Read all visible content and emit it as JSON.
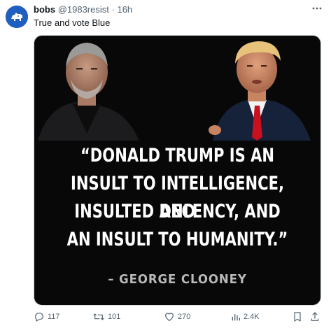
{
  "post": {
    "author_name": "bobs",
    "author_handle": "@1983resist",
    "separator": "·",
    "time": "16h",
    "text": "True and vote Blue",
    "more_icon": "more-horizontal-icon"
  },
  "media": {
    "quote_lines": [
      "“DONALD TRUMP IS AN",
      "INSULT TO INTELLIGENCE, AND",
      "INSULTED DECENCY, AND",
      "AN INSULT TO HUMANITY.”"
    ],
    "attribution": "– GEORGE CLOONEY"
  },
  "actions": {
    "replies": "117",
    "reposts": "101",
    "likes": "270",
    "views": "2.4K",
    "icons": [
      "reply-icon",
      "repost-icon",
      "like-icon",
      "views-icon",
      "bookmark-icon",
      "share-icon"
    ]
  },
  "colors": {
    "accent": "#1f5fbf",
    "muted": "#536471",
    "text": "#0f1419"
  }
}
